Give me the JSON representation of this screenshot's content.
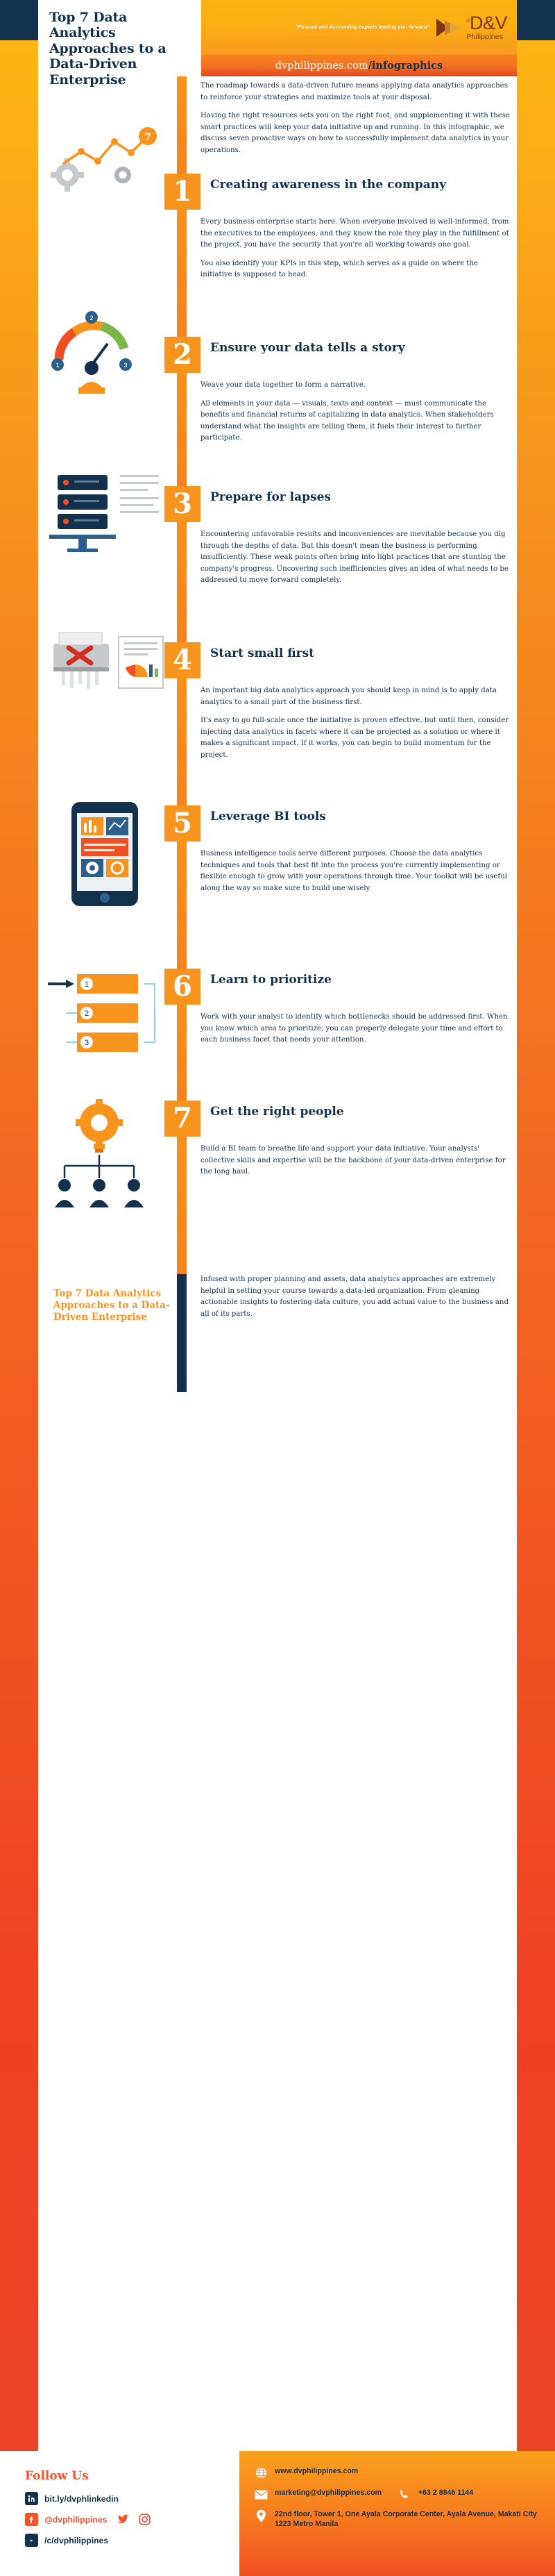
{
  "header": {
    "title": "Top 7 Data Analytics Approaches to a Data-Driven Enterprise",
    "tagline": "\"Finance and Accounting experts leading you forward\"",
    "brand_name": "D&V",
    "brand_sub": "Philippines",
    "url_plain": "dvphilippines.com",
    "url_bold": "/infographics"
  },
  "intro": {
    "p1": "The roadmap towards a data-driven future means applying data analytics approaches to reinforce your strategies and maximize tools at your disposal.",
    "p2": "Having the right resources sets you on the right foot, and supplementing it with these smart practices will keep your data initiative up and running. In this infographic, we discuss seven proactive ways on how to successfully implement data analytics in your operations."
  },
  "sections": [
    {
      "number": "1",
      "title": "Creating awareness in the company",
      "paragraphs": [
        "Every business enterprise starts here. When everyone involved is well-informed, from the executives to the employees, and they know the role they play in the fulfillment of the project, you have the security that you're all working towards one goal.",
        "You also identify your KPIs in this step, which serves as a guide on where the initiative is supposed to head."
      ],
      "art": "line-chart-gears"
    },
    {
      "number": "2",
      "title": "Ensure your data tells a story",
      "paragraphs": [
        "Weave your data together to form a narrative.",
        "All elements in your data — visuals, texts and context — must communicate the benefits and financial returns of capitalizing in data analytics. When stakeholders understand what the insights are telling them, it fuels their interest to further participate."
      ],
      "art": "servers-dashboard"
    },
    {
      "number": "3",
      "title": "Prepare for lapses",
      "paragraphs": [
        "Encountering unfavorable results and inconveniences are inevitable because you dig through the depths of data. But this doesn't mean the business is performing insufficiently. These weak points often bring into light practices that are stunting the company's progress. Uncovering such inefficiencies gives an idea of what needs to be addressed to move forward completely."
      ],
      "art": "shredder-document"
    },
    {
      "number": "4",
      "title": "Start small first",
      "paragraphs": [
        "An important big data analytics approach you should keep in mind is to apply data analytics to a small part of the business first.",
        "It's easy to go full-scale once the initiative is proven effective, but until then, consider injecting data analytics in facets where it can be projected as a solution or where it makes a significant impact. If it works, you can begin to build momentum for the project."
      ],
      "art": "gear-magnifier-bulb"
    },
    {
      "number": "5",
      "title": "Leverage BI tools",
      "paragraphs": [
        "Business intelligence tools serve different purposes. Choose the data analytics techniques and tools that best fit into the process you're currently implementing or flexible enough to grow with your operations through time. Your toolkit will be useful along the way so make sure to build one wisely."
      ],
      "art": "mobile-dashboard"
    },
    {
      "number": "6",
      "title": "Learn to prioritize",
      "paragraphs": [
        "Work with your analyst to identify which bottlenecks should be addressed first. When you know which area to prioritize, you can properly delegate your time and effort to each business facet that needs your attention."
      ],
      "art": "priority-list"
    },
    {
      "number": "7",
      "title": "Get the right people",
      "paragraphs": [
        "Build a BI team to breathe life and support your data initiative. Your analysts' collective skills and expertise will be the backbone of your data-driven enterprise for the long haul.",
        "Infused with proper planning and assets, data analytics approaches are extremely helpful in setting your course towards a data-led organization. From gleaning actionable insights to fostering data culture, you add actual value to the business and all of its parts."
      ],
      "art": "team-bulb"
    }
  ],
  "priority_numbers": [
    "1",
    "2",
    "3"
  ],
  "bottom_title": "Top 7 Data Analytics Approaches to a Data-Driven Enterprise",
  "footer": {
    "follow_us": "Follow Us",
    "socials": [
      {
        "icon": "linkedin-icon",
        "label": "bit.ly/dvphlinkedin",
        "color": "navy"
      },
      {
        "icon": "facebook-icon",
        "label": "@dvphilippines",
        "color": "orange"
      },
      {
        "icon": "youtube-icon",
        "label": "/c/dvphilippines",
        "color": "navy"
      }
    ],
    "extra_social_icons": [
      "twitter-icon",
      "instagram-icon"
    ],
    "contacts": [
      {
        "icon": "globe-icon",
        "text": "www.dvphilippines.com"
      },
      {
        "icon": "mail-icon",
        "text": "marketing@dvphilippines.com"
      },
      {
        "icon": "phone-icon",
        "text": "+63 2 8846 1144"
      },
      {
        "icon": "pin-icon",
        "text": "22nd floor, Tower 1, One Ayala Corporate Center, Ayala Avenue, Makati City 1223 Metro Manila"
      }
    ]
  },
  "colors": {
    "navy": "#13304d",
    "orange": "#f7941e",
    "red_orange": "#f4512c",
    "yellow": "#fcb316"
  }
}
